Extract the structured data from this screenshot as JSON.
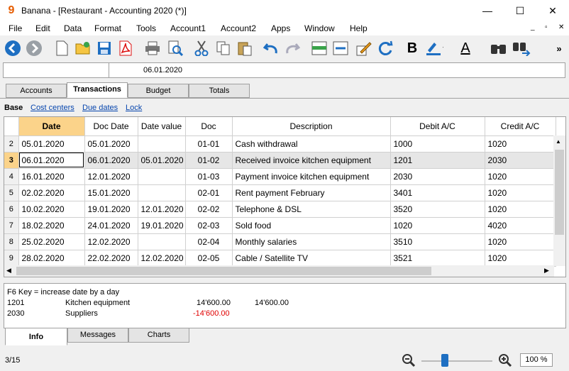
{
  "window": {
    "title": "Banana - [Restaurant - Accounting 2020 (*)]",
    "app_icon_glyph": "9",
    "minimize": "—",
    "maximize": "☐",
    "close": "✕"
  },
  "menu": [
    "File",
    "Edit",
    "Data",
    "Format",
    "Tools",
    "Account1",
    "Account2",
    "Apps",
    "Window",
    "Help"
  ],
  "mdi": {
    "minimize": "_",
    "restore": "▫",
    "close": "✕"
  },
  "toolbar": {
    "icons": [
      "back-icon",
      "forward-icon",
      "new-icon",
      "open-icon",
      "save-icon",
      "pdf-icon",
      "print-icon",
      "print-preview-icon",
      "cut-icon",
      "copy-icon",
      "paste-icon",
      "undo-icon",
      "redo-icon",
      "insert-rows-icon",
      "delete-rows-icon",
      "edit-icon",
      "recheck-icon",
      "bold-icon",
      "highlight-icon",
      "font-color-icon",
      "find-icon",
      "find-next-icon"
    ],
    "bold_label": "B",
    "font_color_label": "A",
    "more": "»"
  },
  "cellbar": {
    "address": "",
    "value": "06.01.2020"
  },
  "tabs": [
    "Accounts",
    "Transactions",
    "Budget",
    "Totals"
  ],
  "active_tab": "Transactions",
  "views": {
    "base": "Base",
    "links": [
      "Cost centers",
      "Due dates",
      "Lock"
    ]
  },
  "grid": {
    "columns": [
      "Date",
      "Doc Date",
      "Date value",
      "Doc",
      "Description",
      "Debit A/C",
      "Credit A/C"
    ],
    "rows": [
      [
        "2",
        "05.01.2020",
        "05.01.2020",
        "",
        "01-01",
        "Cash withdrawal",
        "1000",
        "1020"
      ],
      [
        "3",
        "06.01.2020",
        "06.01.2020",
        "05.01.2020",
        "01-02",
        "Received invoice kitchen equipment",
        "1201",
        "2030"
      ],
      [
        "4",
        "16.01.2020",
        "12.01.2020",
        "",
        "01-03",
        "Payment invoice kitchen equipment",
        "2030",
        "1020"
      ],
      [
        "5",
        "02.02.2020",
        "15.01.2020",
        "",
        "02-01",
        "Rent payment February",
        "3401",
        "1020"
      ],
      [
        "6",
        "10.02.2020",
        "19.01.2020",
        "12.01.2020",
        "02-02",
        "Telephone & DSL",
        "3520",
        "1020"
      ],
      [
        "7",
        "18.02.2020",
        "24.01.2020",
        "19.01.2020",
        "02-03",
        "Sold food",
        "1020",
        "4020"
      ],
      [
        "8",
        "25.02.2020",
        "12.02.2020",
        "",
        "02-04",
        "Monthly salaries",
        "3510",
        "1020"
      ],
      [
        "9",
        "28.02.2020",
        "22.02.2020",
        "12.02.2020",
        "02-05",
        "Cable / Satellite TV",
        "3521",
        "1020"
      ]
    ]
  },
  "info": {
    "line1": "F6 Key = increase date by a day",
    "rows": [
      {
        "account": "1201",
        "name": "Kitchen equipment",
        "amount": "14'600.00",
        "balance": "14'600.00"
      },
      {
        "account": "2030",
        "name": "Suppliers",
        "amount": "-14'600.00",
        "balance": ""
      }
    ]
  },
  "bottom_tabs": [
    "Info",
    "Messages",
    "Charts"
  ],
  "status": {
    "row": "3/15",
    "zoom": "100 %",
    "zoom_level_percent": 100
  },
  "colors": {
    "accent_header": "#fbd38a",
    "negative": "#e00000",
    "link": "#0645ad"
  }
}
